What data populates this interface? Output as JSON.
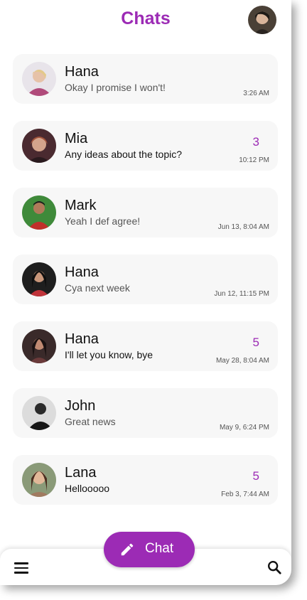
{
  "header": {
    "title": "Chats"
  },
  "chats": [
    {
      "name": "Hana",
      "message": "Okay I promise I won't!",
      "time": "3:26 AM",
      "unread": "",
      "avatar_color": "#b04a7a"
    },
    {
      "name": "Mia",
      "message": "Any ideas about the topic?",
      "time": "10:12 PM",
      "unread": "3",
      "avatar_color": "#8a4a3a"
    },
    {
      "name": "Mark",
      "message": "Yeah I def agree!",
      "time": "Jun 13, 8:04 AM",
      "unread": "",
      "avatar_color": "#3f8a3a"
    },
    {
      "name": "Hana",
      "message": "Cya next week",
      "time": "Jun 12, 11:15 PM",
      "unread": "",
      "avatar_color": "#c0333a"
    },
    {
      "name": "Hana",
      "message": "I'll let you know, bye",
      "time": "May 28, 8:04 AM",
      "unread": "5",
      "avatar_color": "#6a3a3a"
    },
    {
      "name": "John",
      "message": "Great news",
      "time": "May 9, 6:24 PM",
      "unread": "",
      "avatar_color": "#2a2a2a"
    },
    {
      "name": "Lana",
      "message": "Hellooooo",
      "time": "Feb 3, 7:44 AM",
      "unread": "5",
      "avatar_color": "#a07a60"
    }
  ],
  "fab": {
    "label": "Chat"
  },
  "colors": {
    "accent": "#9c2bb5"
  }
}
